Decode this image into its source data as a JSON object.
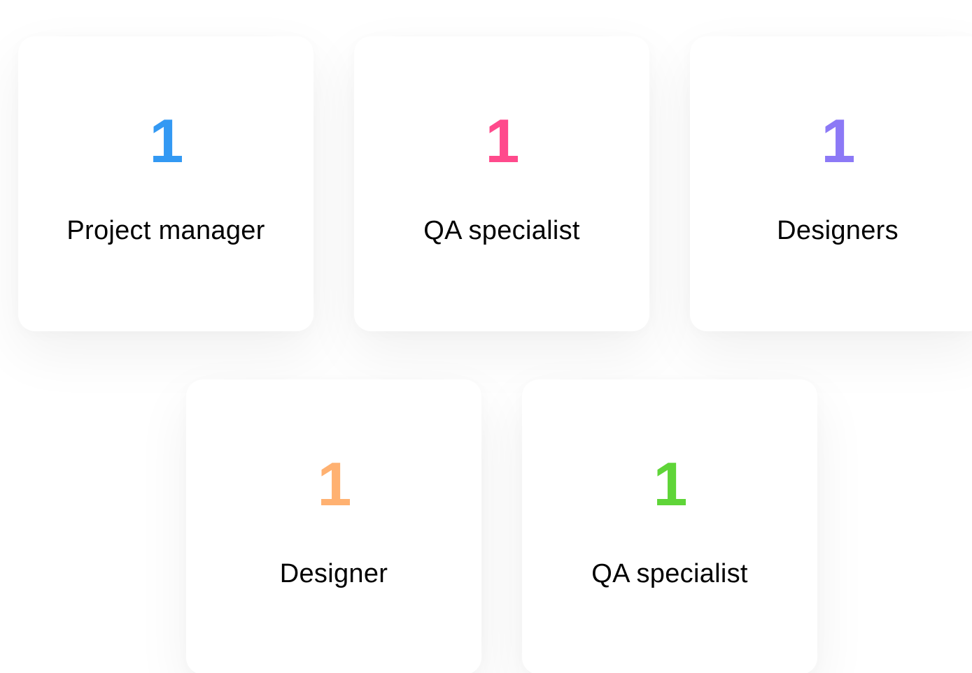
{
  "team": {
    "cards": [
      {
        "count": "1",
        "role": "Project manager",
        "color": "#3399f3"
      },
      {
        "count": "1",
        "role": "QA specialist",
        "color": "#ff4a8c"
      },
      {
        "count": "1",
        "role": "Designers",
        "color": "#8c79f6"
      },
      {
        "count": "1",
        "role": "Designer",
        "color": "#ffb171"
      },
      {
        "count": "1",
        "role": "QA specialist",
        "color": "#5fd538"
      }
    ]
  }
}
